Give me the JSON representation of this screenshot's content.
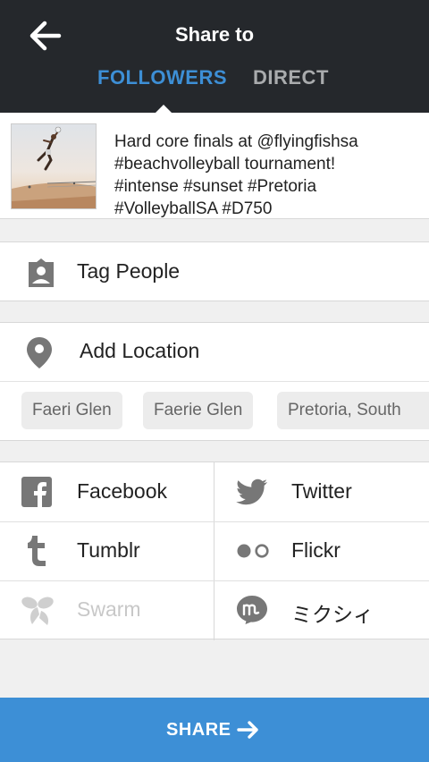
{
  "header": {
    "title": "Share to",
    "tabs": [
      {
        "label": "FOLLOWERS",
        "active": true
      },
      {
        "label": "DIRECT",
        "active": false
      }
    ],
    "colors": {
      "background": "#25282c",
      "active_tab": "#3d8fd6",
      "inactive_tab": "#a9abad"
    }
  },
  "post": {
    "caption": "Hard core finals at @flyingfishsa\n#beachvolleyball tournament!\n#intense #sunset #Pretoria\n#VolleyballSA #D750"
  },
  "options": {
    "tag_people": {
      "label": "Tag People",
      "icon": "tag-person-icon"
    },
    "add_location": {
      "label": "Add Location",
      "icon": "location-pin-icon"
    }
  },
  "location_suggestions": [
    "Faeri Glen",
    "Faerie Glen",
    "Pretoria, South"
  ],
  "share_targets": [
    {
      "label": "Facebook",
      "icon": "facebook-icon",
      "enabled": true
    },
    {
      "label": "Twitter",
      "icon": "twitter-icon",
      "enabled": true
    },
    {
      "label": "Tumblr",
      "icon": "tumblr-icon",
      "enabled": true
    },
    {
      "label": "Flickr",
      "icon": "flickr-icon",
      "enabled": true
    },
    {
      "label": "Swarm",
      "icon": "swarm-icon",
      "enabled": false
    },
    {
      "label": "ミクシィ",
      "icon": "mixi-icon",
      "enabled": true
    }
  ],
  "share_button": {
    "label": "SHARE",
    "icon": "arrow-right-icon",
    "color": "#3d8fd6"
  }
}
